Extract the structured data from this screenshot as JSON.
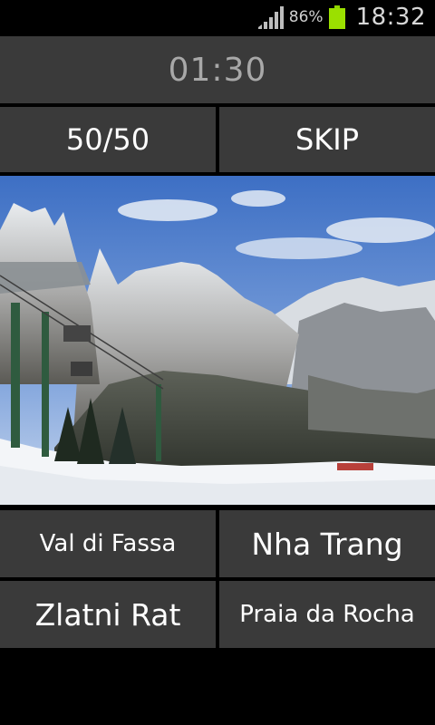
{
  "status_bar": {
    "battery_percent": "86%",
    "time": "18:32",
    "signal_icon": "signal-icon",
    "battery_icon": "battery-icon"
  },
  "timer": {
    "value": "01:30"
  },
  "lifelines": {
    "fifty_fifty_label": "50/50",
    "skip_label": "SKIP"
  },
  "question": {
    "image": "photo-of-snowy-mountains-with-ski-lift"
  },
  "answers": [
    {
      "label": "Val di Fassa"
    },
    {
      "label": "Nha Trang"
    },
    {
      "label": "Zlatni Rat"
    },
    {
      "label": "Praia da Rocha"
    }
  ],
  "colors": {
    "button_bg": "#3a3a3a",
    "background": "#000000",
    "battery": "#9be000"
  }
}
